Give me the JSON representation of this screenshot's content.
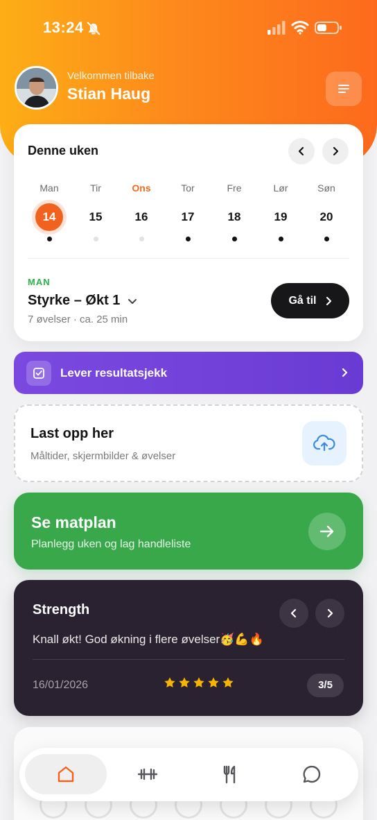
{
  "status_bar": {
    "time": "13:24"
  },
  "header": {
    "greeting": "Velkommen tilbake",
    "user_name": "Stian Haug"
  },
  "week": {
    "title": "Denne uken",
    "days": [
      {
        "label": "Man",
        "date": "14",
        "today": true,
        "has_activity": true
      },
      {
        "label": "Tir",
        "date": "15",
        "today": false,
        "has_activity": false
      },
      {
        "label": "Ons",
        "date": "16",
        "today": false,
        "has_activity": false,
        "highlight_label": true
      },
      {
        "label": "Tor",
        "date": "17",
        "today": false,
        "has_activity": true
      },
      {
        "label": "Fre",
        "date": "18",
        "today": false,
        "has_activity": true
      },
      {
        "label": "Lør",
        "date": "19",
        "today": false,
        "has_activity": true
      },
      {
        "label": "Søn",
        "date": "20",
        "today": false,
        "has_activity": true
      }
    ],
    "workout": {
      "day": "MAN",
      "name": "Styrke – Økt 1",
      "meta": "7 øvelser · ca. 25 min",
      "button": "Gå til"
    }
  },
  "results_check": {
    "label": "Lever resultatsjekk"
  },
  "upload": {
    "title": "Last opp her",
    "subtitle": "Måltider, skjermbilder & øvelser"
  },
  "meal_plan": {
    "title": "Se matplan",
    "subtitle": "Planlegg uken og lag handleliste"
  },
  "feedback": {
    "title": "Strength",
    "message": "Knall økt! God økning i flere øvelser🥳💪🔥",
    "date": "16/01/2026",
    "rating": 5,
    "pager": "3/5"
  },
  "colors": {
    "accent_orange": "#f2621f",
    "purple": "#6a3bd4",
    "green": "#38a84a",
    "dark_card": "#2a2230",
    "star": "#f7b500"
  },
  "tabs": [
    {
      "icon": "home-icon",
      "active": true
    },
    {
      "icon": "dumbbell-icon",
      "active": false
    },
    {
      "icon": "fork-knife-icon",
      "active": false
    },
    {
      "icon": "chat-bubble-icon",
      "active": false
    }
  ]
}
